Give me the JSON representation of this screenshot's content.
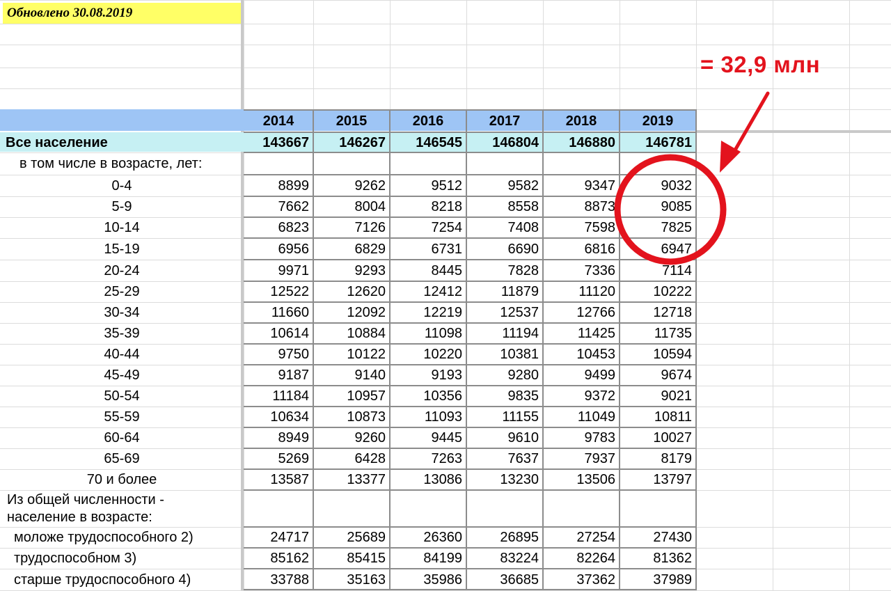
{
  "note": "Обновлено 30.08.2019",
  "annotation": {
    "text": "= 32,9 млн",
    "color": "#e3131d"
  },
  "header": {
    "years": [
      "2014",
      "2015",
      "2016",
      "2017",
      "2018",
      "2019"
    ]
  },
  "total": {
    "label": "Все население",
    "values": [
      "143667",
      "146267",
      "146545",
      "146804",
      "146880",
      "146781"
    ]
  },
  "subheader": "в том числе в возрасте,  лет:",
  "age_rows": [
    {
      "label": "0-4",
      "values": [
        "8899",
        "9262",
        "9512",
        "9582",
        "9347",
        "9032"
      ]
    },
    {
      "label": "5-9",
      "values": [
        "7662",
        "8004",
        "8218",
        "8558",
        "8873",
        "9085"
      ]
    },
    {
      "label": "10-14",
      "values": [
        "6823",
        "7126",
        "7254",
        "7408",
        "7598",
        "7825"
      ]
    },
    {
      "label": "15-19",
      "values": [
        "6956",
        "6829",
        "6731",
        "6690",
        "6816",
        "6947"
      ]
    },
    {
      "label": "20-24",
      "values": [
        "9971",
        "9293",
        "8445",
        "7828",
        "7336",
        "7114"
      ]
    },
    {
      "label": "25-29",
      "values": [
        "12522",
        "12620",
        "12412",
        "11879",
        "11120",
        "10222"
      ]
    },
    {
      "label": "30-34",
      "values": [
        "11660",
        "12092",
        "12219",
        "12537",
        "12766",
        "12718"
      ]
    },
    {
      "label": "35-39",
      "values": [
        "10614",
        "10884",
        "11098",
        "11194",
        "11425",
        "11735"
      ]
    },
    {
      "label": "40-44",
      "values": [
        "9750",
        "10122",
        "10220",
        "10381",
        "10453",
        "10594"
      ]
    },
    {
      "label": "45-49",
      "values": [
        "9187",
        "9140",
        "9193",
        "9280",
        "9499",
        "9674"
      ]
    },
    {
      "label": "50-54",
      "values": [
        "11184",
        "10957",
        "10356",
        "9835",
        "9372",
        "9021"
      ]
    },
    {
      "label": "55-59",
      "values": [
        "10634",
        "10873",
        "11093",
        "11155",
        "11049",
        "10811"
      ]
    },
    {
      "label": "60-64",
      "values": [
        "8949",
        "9260",
        "9445",
        "9610",
        "9783",
        "10027"
      ]
    },
    {
      "label": "65-69",
      "values": [
        "5269",
        "6428",
        "7263",
        "7637",
        "7937",
        "8179"
      ]
    },
    {
      "label": "70 и более",
      "values": [
        "13587",
        "13377",
        "13086",
        "13230",
        "13506",
        "13797"
      ]
    }
  ],
  "group_header": {
    "line1": "Из общей численности -",
    "line2": "население в возрасте:"
  },
  "group_rows": [
    {
      "label": "моложе трудоспособного 2)",
      "values": [
        "24717",
        "25689",
        "26360",
        "26895",
        "27254",
        "27430"
      ]
    },
    {
      "label": "трудоспособном 3)",
      "values": [
        "85162",
        "85415",
        "84199",
        "83224",
        "82264",
        "81362"
      ]
    },
    {
      "label": "старше трудоспособного  4)",
      "values": [
        "33788",
        "35163",
        "35986",
        "36685",
        "37362",
        "37989"
      ]
    }
  ]
}
